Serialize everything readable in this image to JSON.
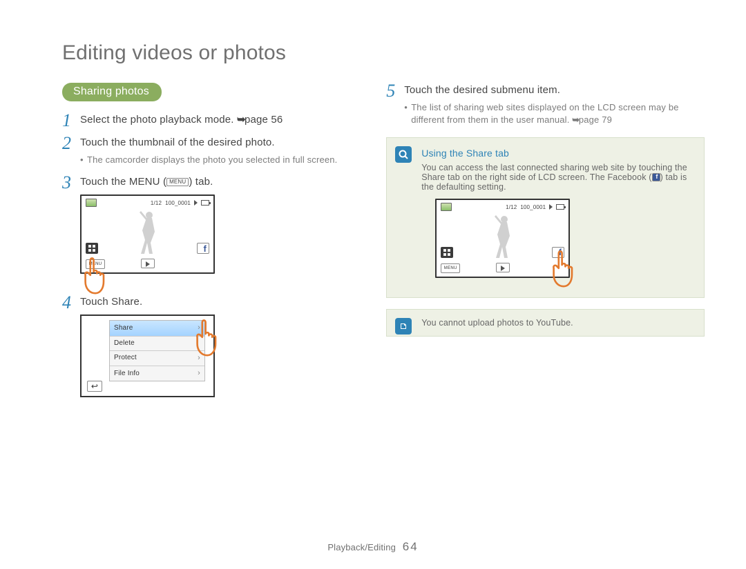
{
  "page_title": "Editing videos or photos",
  "section_pill": "Sharing photos",
  "steps_left": {
    "s1": {
      "text_pre": "Select the photo playback mode. ",
      "pageref": "page 56"
    },
    "s2": {
      "text": "Touch the thumbnail of the desired photo.",
      "sub": "The camcorder displays the photo you selected in full screen."
    },
    "s3": {
      "pre": "Touch the MENU (",
      "chip": "MENU",
      "post": ") tab."
    },
    "s4": {
      "pre": "Touch ",
      "bold": "Share",
      "post": "."
    }
  },
  "steps_right": {
    "s5": {
      "text": "Touch the desired submenu item.",
      "sub_pre": "The list of sharing web sites displayed on the LCD screen may be different from them in the user manual. ",
      "sub_page": "page 79"
    }
  },
  "lcd": {
    "counter": "1/12",
    "filecode": "100_0001",
    "menu_label": "MENU"
  },
  "menu_items": [
    "Share",
    "Delete",
    "Protect",
    "File Info"
  ],
  "callout_share": {
    "title": "Using the Share tab",
    "body_pre": "You can access the last connected sharing web site by touching the Share tab on the right side of LCD screen. The Facebook (",
    "body_post": ") tab is the defaulting setting."
  },
  "callout_note": "You cannot upload photos to YouTube.",
  "footer": {
    "section": "Playback/Editing",
    "page": "64"
  }
}
